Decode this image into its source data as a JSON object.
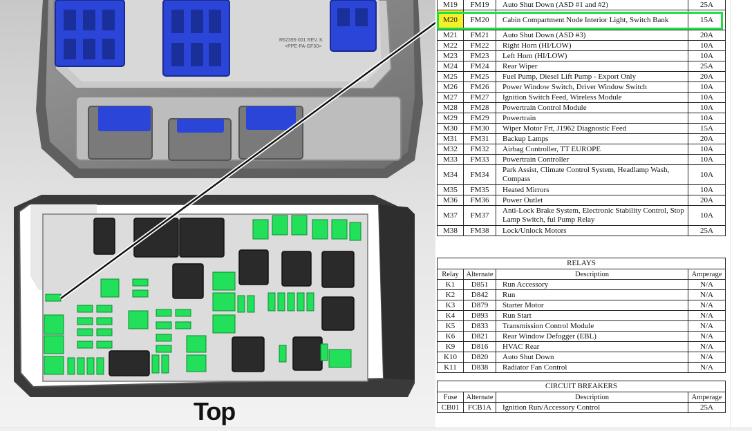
{
  "diagram": {
    "view_label": "Top",
    "part_number_line1": "R62395-001 REV. K",
    "part_number_line2": "<PPE-PA-GF30>",
    "colors": {
      "connector": "#2a45d8",
      "fuse": "#22e05a",
      "relay": "#2a2a2a",
      "housing": "#7a7a7a",
      "highlight": "#f5f02a",
      "highlight_box": "#22dd44"
    }
  },
  "fuses": {
    "rows": [
      {
        "fuse": "M19",
        "alt": "FM19",
        "desc": "Auto Shut Down (ASD #1 and #2)",
        "amp": "25A"
      },
      {
        "fuse": "M20",
        "alt": "FM20",
        "desc": "Cabin Compartment Node Interior Light, Switch Bank",
        "amp": "15A"
      },
      {
        "fuse": "M21",
        "alt": "FM21",
        "desc": "Auto Shut Down (ASD #3)",
        "amp": "20A"
      },
      {
        "fuse": "M22",
        "alt": "FM22",
        "desc": "Right Horn (HI/LOW)",
        "amp": "10A"
      },
      {
        "fuse": "M23",
        "alt": "FM23",
        "desc": "Left Horn (HI/LOW)",
        "amp": "10A"
      },
      {
        "fuse": "M24",
        "alt": "FM24",
        "desc": "Rear Wiper",
        "amp": "25A"
      },
      {
        "fuse": "M25",
        "alt": "FM25",
        "desc": "Fuel Pump, Diesel Lift Pump - Export Only",
        "amp": "20A"
      },
      {
        "fuse": "M26",
        "alt": "FM26",
        "desc": "Power Window Switch, Driver Window Switch",
        "amp": "10A"
      },
      {
        "fuse": "M27",
        "alt": "FM27",
        "desc": "Ignition Switch Feed, Wireless Module",
        "amp": "10A"
      },
      {
        "fuse": "M28",
        "alt": "FM28",
        "desc": "Powertrain Control Module",
        "amp": "10A"
      },
      {
        "fuse": "M29",
        "alt": "FM29",
        "desc": "Powertrain",
        "amp": "10A"
      },
      {
        "fuse": "M30",
        "alt": "FM30",
        "desc": "Wiper Motor Frt, J1962 Diagnostic Feed",
        "amp": "15A"
      },
      {
        "fuse": "M31",
        "alt": "FM31",
        "desc": "Backup Lamps",
        "amp": "20A"
      },
      {
        "fuse": "M32",
        "alt": "FM32",
        "desc": "Airbag Controller, TT EUROPE",
        "amp": "10A"
      },
      {
        "fuse": "M33",
        "alt": "FM33",
        "desc": "Powertrain Controller",
        "amp": "10A"
      },
      {
        "fuse": "M34",
        "alt": "FM34",
        "desc": "Park Assist, Climate Control System, Headlamp Wash, Compass",
        "amp": "10A"
      },
      {
        "fuse": "M35",
        "alt": "FM35",
        "desc": "Heated Mirrors",
        "amp": "10A"
      },
      {
        "fuse": "M36",
        "alt": "FM36",
        "desc": "Power Outlet",
        "amp": "20A"
      },
      {
        "fuse": "M37",
        "alt": "FM37",
        "desc": "Anti-Lock Brake System, Electronic Stability Control, Stop Lamp Switch, ful Pump Relay",
        "amp": "10A"
      },
      {
        "fuse": "M38",
        "alt": "FM38",
        "desc": "Lock/Unlock Motors",
        "amp": "25A"
      }
    ]
  },
  "relays": {
    "caption": "RELAYS",
    "headers": [
      "Relay",
      "Alternate",
      "Description",
      "Amperage"
    ],
    "rows": [
      {
        "relay": "K1",
        "alt": "D851",
        "desc": "Run Accessory",
        "amp": "N/A"
      },
      {
        "relay": "K2",
        "alt": "D842",
        "desc": "Run",
        "amp": "N/A"
      },
      {
        "relay": "K3",
        "alt": "D879",
        "desc": "Starter Motor",
        "amp": "N/A"
      },
      {
        "relay": "K4",
        "alt": "D893",
        "desc": "Run Start",
        "amp": "N/A"
      },
      {
        "relay": "K5",
        "alt": "D833",
        "desc": "Transmission Control Module",
        "amp": "N/A"
      },
      {
        "relay": "K6",
        "alt": "D821",
        "desc": "Rear Window Defogger (EBL)",
        "amp": "N/A"
      },
      {
        "relay": "K9",
        "alt": "D816",
        "desc": "HVAC Rear",
        "amp": "N/A"
      },
      {
        "relay": "K10",
        "alt": "D820",
        "desc": "Auto Shut Down",
        "amp": "N/A"
      },
      {
        "relay": "K11",
        "alt": "D838",
        "desc": "Radiator Fan Control",
        "amp": "N/A"
      }
    ]
  },
  "breakers": {
    "caption": "CIRCUIT BREAKERS",
    "headers": [
      "Fuse",
      "Alternate",
      "Description",
      "Amperage"
    ],
    "rows": [
      {
        "fuse": "CB01",
        "alt": "FCB1A",
        "desc": "Ignition Run/Accessory Control",
        "amp": "25A"
      }
    ]
  }
}
